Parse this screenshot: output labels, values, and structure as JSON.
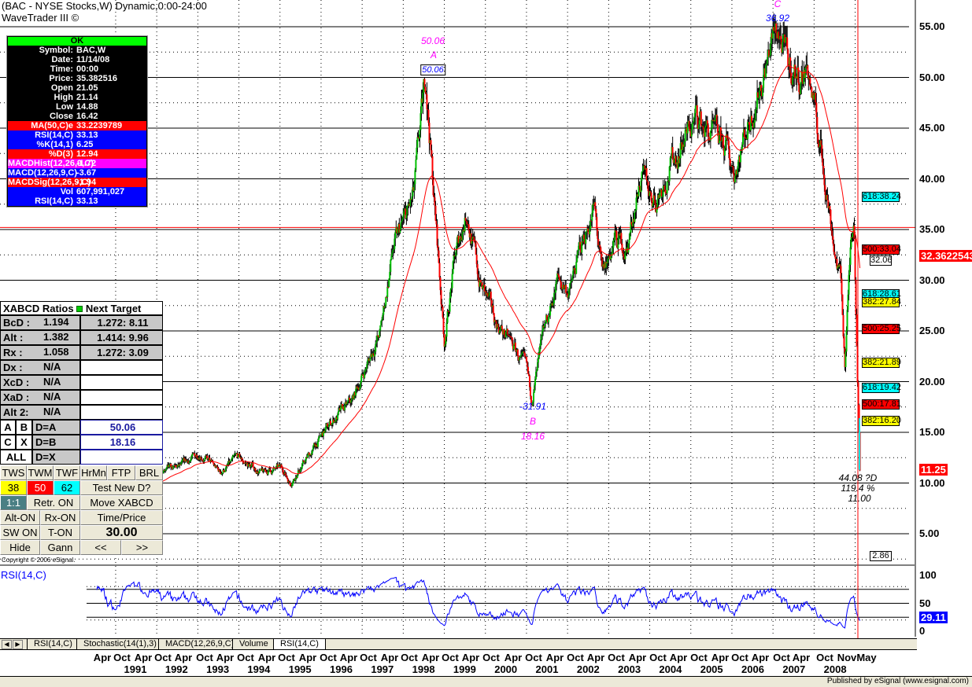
{
  "header": {
    "title": "(BAC - NYSE Stocks,W) Dynamic,0:00-24:00",
    "subtitle": "WaveTrader III ©"
  },
  "data_window": {
    "status": "OK",
    "rows": [
      {
        "k": "Symbol:",
        "v": "BAC,W",
        "bg": "#000000"
      },
      {
        "k": "Date:",
        "v": "11/14/08",
        "bg": "#000000"
      },
      {
        "k": "Time:",
        "v": "00:00",
        "bg": "#000000"
      },
      {
        "k": "Price:",
        "v": "35.382516",
        "bg": "#000000"
      },
      {
        "k": "Open",
        "v": "21.05",
        "bg": "#000000"
      },
      {
        "k": "High",
        "v": "21.14",
        "bg": "#000000"
      },
      {
        "k": "Low",
        "v": "14.88",
        "bg": "#000000"
      },
      {
        "k": "Close",
        "v": "16.42",
        "bg": "#000000"
      },
      {
        "k": "MA(50,C)e",
        "v": "33.2239789",
        "bg": "#ff0000"
      },
      {
        "k": "RSI(14,C)",
        "v": "33.13",
        "bg": "#0000ff"
      },
      {
        "k": "%K(14,1)",
        "v": "6.25",
        "bg": "#0000ff"
      },
      {
        "k": "%D(3)",
        "v": "12.94",
        "bg": "#ff0000"
      },
      {
        "k": "MACDHist(12,26,9,C)",
        "v": "-1.72",
        "bg": "#ff00ff"
      },
      {
        "k": "MACD(12,26,9,C)",
        "v": "-3.67",
        "bg": "#0000ff"
      },
      {
        "k": "MACDSig(12,26,9,C)",
        "v": "-1.94",
        "bg": "#ff0000"
      },
      {
        "k": "Vol",
        "v": "607,991,027",
        "bg": "#0000ff"
      },
      {
        "k": "RSI(14,C)",
        "v": "33.13",
        "bg": "#0000ff"
      }
    ]
  },
  "xabcd": {
    "header": "XABCD Ratios",
    "header2": "Next Target",
    "rows": [
      {
        "k": "BcD :",
        "v": "1.194",
        "t": "1.272: 8.11"
      },
      {
        "k": "Alt  :",
        "v": "1.382",
        "t": "1.414: 9.96"
      },
      {
        "k": "Rx  :",
        "v": "1.058",
        "t": "1.272: 3.09"
      },
      {
        "k": "Dx  :",
        "v": "N/A",
        "t": ""
      },
      {
        "k": "XcD :",
        "v": "N/A",
        "t": ""
      },
      {
        "k": "XaD :",
        "v": "N/A",
        "t": ""
      },
      {
        "k": "Alt 2:",
        "v": "N/A",
        "t": ""
      }
    ],
    "pts": {
      "a": "A",
      "b": "B",
      "c": "C",
      "x": "X",
      "all": "ALL",
      "da": "D=A",
      "db": "D=B",
      "dx": "D=X",
      "da_val": "50.06",
      "db_val": "18.16"
    },
    "buttons": {
      "tws": "TWS",
      "twm": "TWM",
      "twf": "TWF",
      "hrmn": "HrMn",
      "ftp": "FTP",
      "brl": "BRL",
      "n38": "38",
      "n50": "50",
      "n62": "62",
      "test": "Test New D?",
      "ratio": "1:1",
      "retr": "Retr. ON",
      "move": "Move XABCD",
      "alt": "Alt-ON",
      "rx": "Rx-ON",
      "tp": "Time/Price",
      "sw": "SW ON",
      "ton": "T-ON",
      "val": "30.00",
      "hide": "Hide",
      "gann": "Gann",
      "prev": "<<",
      "next": ">>"
    },
    "copyright": "Copyright © 2006 eSignal."
  },
  "annotations": {
    "a_price": "50.06",
    "a_label": "A",
    "a_box": "50.06",
    "c_label": "C",
    "c_val": "36.92",
    "b_val": "-31.91",
    "b_label": "B",
    "b_price": "18.16",
    "d1": "44.08 ?D",
    "d2": "119.4 %",
    "d3": "11.00"
  },
  "fib_boxes": [
    {
      "t": "618:38.24",
      "c": "#00ffff",
      "p": 38.24
    },
    {
      "t": "500:33.04",
      "c": "#ff0000",
      "p": 33.04
    },
    {
      "t": "32.06",
      "c": "#ffffff",
      "p": 32.0
    },
    {
      "t": "618:28.61",
      "c": "#00ffff",
      "p": 28.61
    },
    {
      "t": "382:27.84",
      "c": "#ffff00",
      "p": 27.84
    },
    {
      "t": "500:25.25",
      "c": "#ff0000",
      "p": 25.25
    },
    {
      "t": "382:21.89",
      "c": "#ffff00",
      "p": 21.89
    },
    {
      "t": "618:19.42",
      "c": "#00ffff",
      "p": 19.42
    },
    {
      "t": "500:17.81",
      "c": "#ff0000",
      "p": 17.81
    },
    {
      "t": "382:16.20",
      "c": "#ffff00",
      "p": 16.2
    },
    {
      "t": "2.86",
      "c": "#ffffff",
      "p": 2.86
    }
  ],
  "price_axis": {
    "ticks": [
      "55.00",
      "50.00",
      "45.00",
      "40.00",
      "35.00",
      "30.00",
      "25.00",
      "20.00",
      "15.00",
      "10.00",
      "5.00"
    ],
    "last_ma": "32.3622543",
    "last_price": "11.25"
  },
  "rsi_panel": {
    "title": "RSI(14,C)",
    "ticks": [
      "100",
      "50",
      "0"
    ],
    "last": "29.11"
  },
  "tabs": [
    "RSI(14,C)",
    "Stochastic(14(1),3)",
    "MACD(12,26,9,C)",
    "Volume",
    "RSI(14,C)"
  ],
  "date_axis": {
    "months": [
      "Apr",
      "Oct",
      "Apr",
      "Oct",
      "Apr",
      "Oct",
      "Apr",
      "Oct",
      "Apr",
      "Oct",
      "Apr",
      "Oct",
      "Apr",
      "Oct",
      "Apr",
      "Oct",
      "Apr",
      "Oct",
      "Apr",
      "Oct",
      "Apr",
      "Oct",
      "Apr",
      "Oct",
      "Apr",
      "Oct",
      "Apr",
      "Oct",
      "Apr",
      "Oct",
      "Apr",
      "Oct",
      "Apr",
      "Oct",
      "Apr",
      "Oct",
      "Nov",
      "May",
      "Nov"
    ],
    "years": [
      "1991",
      "1992",
      "1993",
      "1994",
      "1995",
      "1996",
      "1997",
      "1998",
      "1999",
      "2000",
      "2001",
      "2002",
      "2003",
      "2004",
      "2005",
      "2006",
      "2007",
      "2008"
    ]
  },
  "status": "Published by eSignal (www.esignal.com)",
  "chart_data": {
    "type": "candlestick",
    "title": "BAC - NYSE Stocks, Weekly",
    "ylim": [
      2,
      57
    ],
    "xlim": [
      1990.0,
      2008.87
    ],
    "interval": "weekly",
    "keypoints": [
      [
        1990.0,
        7
      ],
      [
        1990.4,
        8
      ],
      [
        1990.8,
        7.2
      ],
      [
        1991.3,
        10.5
      ],
      [
        1991.8,
        11
      ],
      [
        1992.3,
        11.5
      ],
      [
        1992.8,
        13
      ],
      [
        1993.3,
        11
      ],
      [
        1993.7,
        12.5
      ],
      [
        1994.3,
        11
      ],
      [
        1994.8,
        11.5
      ],
      [
        1995.0,
        10
      ],
      [
        1995.5,
        13
      ],
      [
        1996.0,
        16
      ],
      [
        1996.5,
        18
      ],
      [
        1996.9,
        22
      ],
      [
        1997.2,
        25
      ],
      [
        1997.5,
        33
      ],
      [
        1997.8,
        36
      ],
      [
        1998.0,
        38
      ],
      [
        1998.15,
        44
      ],
      [
        1998.3,
        50.06
      ],
      [
        1998.5,
        38
      ],
      [
        1998.75,
        24
      ],
      [
        1999.0,
        32
      ],
      [
        1999.3,
        37
      ],
      [
        1999.6,
        30
      ],
      [
        2000.0,
        26
      ],
      [
        2000.5,
        23
      ],
      [
        2000.75,
        21
      ],
      [
        2000.87,
        18.16
      ],
      [
        2001.2,
        25
      ],
      [
        2001.5,
        30
      ],
      [
        2001.8,
        29
      ],
      [
        2002.2,
        35
      ],
      [
        2002.4,
        37
      ],
      [
        2002.6,
        30
      ],
      [
        2002.9,
        34
      ],
      [
        2003.2,
        33
      ],
      [
        2003.5,
        40
      ],
      [
        2003.9,
        38
      ],
      [
        2004.2,
        41
      ],
      [
        2004.6,
        44
      ],
      [
        2004.9,
        46
      ],
      [
        2005.3,
        44
      ],
      [
        2005.6,
        43
      ],
      [
        2005.8,
        41
      ],
      [
        2006.1,
        45
      ],
      [
        2006.4,
        49
      ],
      [
        2006.7,
        53
      ],
      [
        2006.87,
        54.9
      ],
      [
        2007.1,
        51
      ],
      [
        2007.4,
        50
      ],
      [
        2007.6,
        51
      ],
      [
        2007.9,
        43
      ],
      [
        2008.1,
        38
      ],
      [
        2008.25,
        33
      ],
      [
        2008.4,
        30
      ],
      [
        2008.5,
        22
      ],
      [
        2008.65,
        34
      ],
      [
        2008.72,
        37
      ],
      [
        2008.8,
        22
      ],
      [
        2008.87,
        11.25
      ]
    ],
    "ma": {
      "name": "MA(50,C)e",
      "color": "#ff0000",
      "last": 32.3622543
    },
    "rsi": {
      "name": "RSI(14,C)",
      "last": 29.11,
      "levels": [
        80,
        75,
        50,
        25,
        20
      ]
    },
    "marker_date": "Nov 2008"
  }
}
